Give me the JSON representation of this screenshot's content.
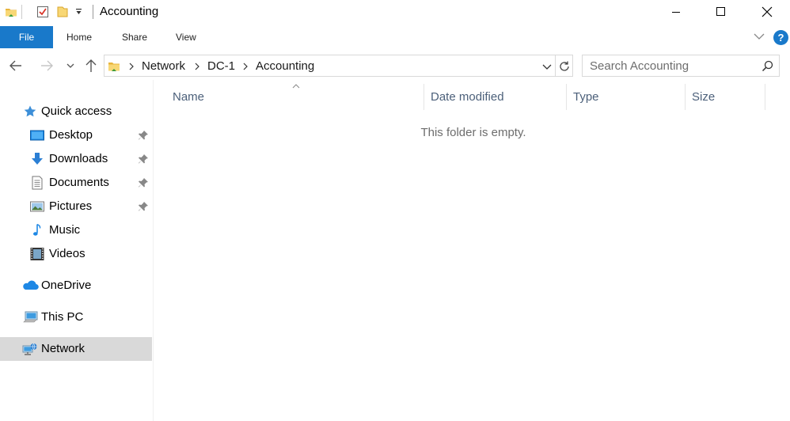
{
  "window": {
    "title": "Accounting"
  },
  "ribbon": {
    "file": "File",
    "tabs": [
      "Home",
      "Share",
      "View"
    ],
    "help": "?"
  },
  "address": {
    "crumbs": [
      "Network",
      "DC-1",
      "Accounting"
    ]
  },
  "search": {
    "placeholder": "Search Accounting"
  },
  "sidebar": {
    "quick_access": "Quick access",
    "items": [
      {
        "label": "Desktop",
        "icon": "desktop-icon",
        "pinned": true
      },
      {
        "label": "Downloads",
        "icon": "downloads-icon",
        "pinned": true
      },
      {
        "label": "Documents",
        "icon": "documents-icon",
        "pinned": true
      },
      {
        "label": "Pictures",
        "icon": "pictures-icon",
        "pinned": true
      },
      {
        "label": "Music",
        "icon": "music-icon",
        "pinned": false
      },
      {
        "label": "Videos",
        "icon": "videos-icon",
        "pinned": false
      }
    ],
    "onedrive": "OneDrive",
    "this_pc": "This PC",
    "network": "Network",
    "selected": "Network"
  },
  "columns": [
    "Name",
    "Date modified",
    "Type",
    "Size"
  ],
  "content": {
    "empty_message": "This folder is empty."
  },
  "colors": {
    "accent": "#1979ca",
    "selected_bg": "#d9d9d9",
    "column_header": "#4c607a"
  }
}
